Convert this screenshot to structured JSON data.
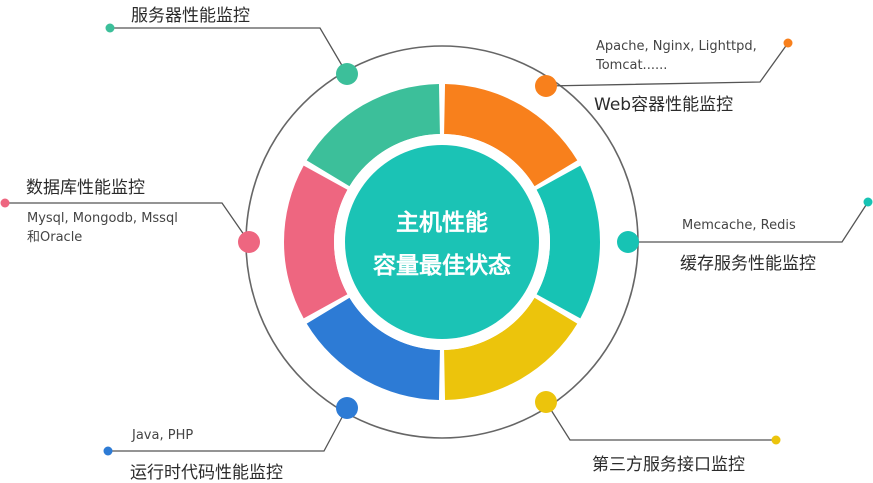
{
  "center": {
    "line1": "主机性能",
    "line2": "容量最佳状态",
    "color": "#1bc3b5"
  },
  "colors": {
    "green": "#3cbf9a",
    "orange": "#f8801c",
    "teal": "#17c3b4",
    "yellow": "#ecc40c",
    "blue": "#2d7bd5",
    "pink": "#ee6680",
    "line": "#555555",
    "ring": "#666666"
  },
  "items": {
    "server": {
      "title": "服务器性能监控",
      "color": "#3cbf9a"
    },
    "web": {
      "title": "Web容器性能监控",
      "sub1": "Apache, Nginx, Lighttpd,",
      "sub2": "Tomcat......",
      "color": "#f8801c"
    },
    "cache": {
      "title": "缓存服务性能监控",
      "sub1": "Memcache, Redis",
      "color": "#17c3b4"
    },
    "thirdparty": {
      "title": "第三方服务接口监控",
      "color": "#ecc40c"
    },
    "runtime": {
      "title": "运行时代码性能监控",
      "sub1": "Java, PHP",
      "color": "#2d7bd5"
    },
    "database": {
      "title": "数据库性能监控",
      "sub1": "Mysql, Mongodb, Mssql",
      "sub2": "和Oracle",
      "color": "#ee6680"
    }
  }
}
